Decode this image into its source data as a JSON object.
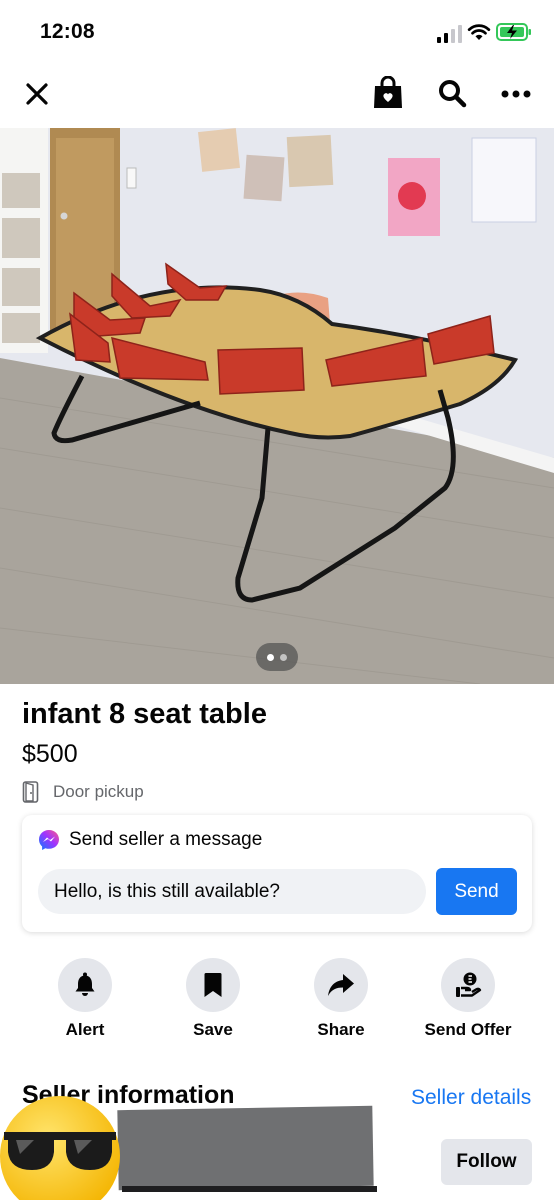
{
  "status_bar": {
    "time": "12:08"
  },
  "listing": {
    "title": "infant 8 seat table",
    "price": "$500",
    "pickup": "Door pickup",
    "photo_count": 2,
    "photo_index": 1
  },
  "message": {
    "header": "Send seller a message",
    "input_value": "Hello, is this still available?",
    "send_label": "Send"
  },
  "actions": [
    {
      "label": "Alert",
      "icon": "bell-icon"
    },
    {
      "label": "Save",
      "icon": "bookmark-icon"
    },
    {
      "label": "Share",
      "icon": "share-arrow-icon"
    },
    {
      "label": "Send Offer",
      "icon": "offer-icon"
    }
  ],
  "seller": {
    "heading": "Seller information",
    "details_link": "Seller details",
    "follow_label": "Follow"
  },
  "colors": {
    "accent": "#1877f2",
    "button_gray": "#e4e6eb",
    "input_bg": "#f0f2f5",
    "secondary_text": "#65676b"
  }
}
